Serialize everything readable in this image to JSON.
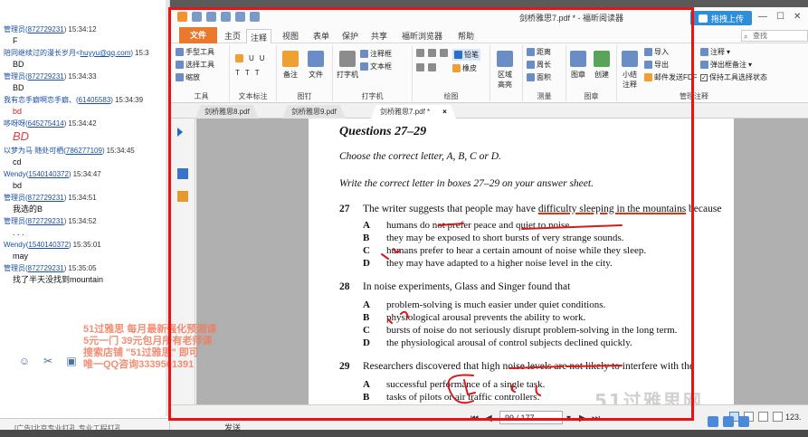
{
  "chat": {
    "messages": [
      {
        "user": "管理员(",
        "uid": "872729231",
        "time": "15:34:12",
        "text": "F",
        "style": "normal"
      },
      {
        "user": "陪同继续过的漫长岁月<",
        "uid": "huyyu@qq.com",
        "time": "15:3",
        "text": "BD",
        "style": "normal"
      },
      {
        "user": "管理员(",
        "uid": "872729231",
        "time": "15:34:33",
        "text": "BD",
        "style": "normal"
      },
      {
        "user": "我有恋手癖啊恋手癖、(",
        "uid": "61405583",
        "time": "15:34:39",
        "text": "bd",
        "style": "red"
      },
      {
        "user": "哆呀呀(",
        "uid": "645275414",
        "time": "15:34:42",
        "text": "BD",
        "style": "big"
      },
      {
        "user": "以梦为马 随处可栖(",
        "uid": "786277109",
        "time": "15:34:45",
        "text": "cd",
        "style": "normal"
      },
      {
        "user": "Wendy(",
        "uid": "1540140372",
        "time": "15:34:47",
        "text": "bd",
        "style": "normal"
      },
      {
        "user": "管理员(",
        "uid": "872729231",
        "time": "15:34:51",
        "text": "我选的B",
        "style": "normal"
      },
      {
        "user": "管理员(",
        "uid": "872729231",
        "time": "15:34:52",
        "text": ". . .",
        "style": "normal"
      },
      {
        "user": "Wendy(",
        "uid": "1540140372",
        "time": "15:35:01",
        "text": "may",
        "style": "normal"
      },
      {
        "user": "管理员(",
        "uid": "872729231",
        "time": "15:35:05",
        "text": "找了半天没找到mountain",
        "style": "normal"
      }
    ],
    "tool_icons": [
      "smiley-icon",
      "scissors-icon",
      "image-icon"
    ],
    "ad_lines": [
      "51过雅思 每月最新强化预测课",
      "5元一门 39元包月所有老师课",
      "搜索店铺 \"51过雅思\" 即可",
      "唯一QQ咨询3339561391"
    ],
    "input_ad": "[广告]北京专业打孔 专业工程打孔",
    "send_label": "发送"
  },
  "app": {
    "window_title": "剑桥雅思7.pdf * - 福昕阅读器",
    "upload_label": "拖拽上传",
    "ribbon_tabs": [
      "文件",
      "主页",
      "注释",
      "视图",
      "表单",
      "保护",
      "共享",
      "福昕浏览器",
      "帮助"
    ],
    "active_ribbon_tab": "注释",
    "search_placeholder": "查找",
    "ribbon": {
      "tools": {
        "label": "工具",
        "items": [
          "手型工具",
          "选择工具",
          "缩放"
        ]
      },
      "text_markup": {
        "label": "文本标注",
        "items": [
          "U",
          "U",
          "T",
          "T",
          "T"
        ]
      },
      "pin": {
        "label": "图钉",
        "items": [
          "备注",
          "文件"
        ]
      },
      "typewriter": {
        "label": "打字机",
        "items": [
          "打字机",
          "注释框",
          "文本框"
        ]
      },
      "drawing": {
        "label": "绘图",
        "items": [
          "铅笔",
          "橡皮"
        ]
      },
      "area": {
        "label": "",
        "items": [
          "区域高亮"
        ]
      },
      "measure": {
        "label": "测量",
        "items": [
          "距离",
          "周长",
          "面积"
        ]
      },
      "stamp": {
        "label": "图章",
        "items": [
          "图章",
          "创建"
        ]
      },
      "manage": {
        "label": "管理注释",
        "items": [
          "小结注释",
          "导入",
          "导出",
          "邮件发送FDF",
          "注释",
          "弹出框备注",
          "保持工具选择状态"
        ]
      }
    },
    "doc_tabs": [
      {
        "label": "剑桥雅思8.pdf",
        "active": false
      },
      {
        "label": "剑桥雅思9.pdf",
        "active": false
      },
      {
        "label": "剑桥雅思7.pdf *",
        "active": true
      }
    ],
    "status": {
      "page_value": "99 / 177",
      "zoom": "123."
    }
  },
  "pdf": {
    "heading": "Questions 27–29",
    "instruction1": "Choose the correct letter, A, B, C or D.",
    "instruction2": "Write the correct letter in boxes 27–29 on your answer sheet.",
    "questions": [
      {
        "num": "27",
        "stem": "The writer suggests that people may have difficulty sleeping in the mountains because",
        "options": [
          {
            "letter": "A",
            "text": "humans do not prefer peace and quiet to noise."
          },
          {
            "letter": "B",
            "text": "they may be exposed to short bursts of very strange sounds."
          },
          {
            "letter": "C",
            "text": "humans prefer to hear a certain amount of noise while they sleep."
          },
          {
            "letter": "D",
            "text": "they may have adapted to a higher noise level in the city."
          }
        ]
      },
      {
        "num": "28",
        "stem": "In noise experiments, Glass and Singer found that",
        "options": [
          {
            "letter": "A",
            "text": "problem-solving is much easier under quiet conditions."
          },
          {
            "letter": "B",
            "text": "physiological arousal prevents the ability to work."
          },
          {
            "letter": "C",
            "text": "bursts of noise do not seriously disrupt problem-solving in the long term."
          },
          {
            "letter": "D",
            "text": "the physiological arousal of control subjects declined quickly."
          }
        ]
      },
      {
        "num": "29",
        "stem": "Researchers discovered that high noise levels are not likely to interfere with the",
        "options": [
          {
            "letter": "A",
            "text": "successful performance of a single task."
          },
          {
            "letter": "B",
            "text": "tasks of pilots or air traffic controllers."
          }
        ]
      }
    ],
    "watermark": "51过雅思网"
  }
}
